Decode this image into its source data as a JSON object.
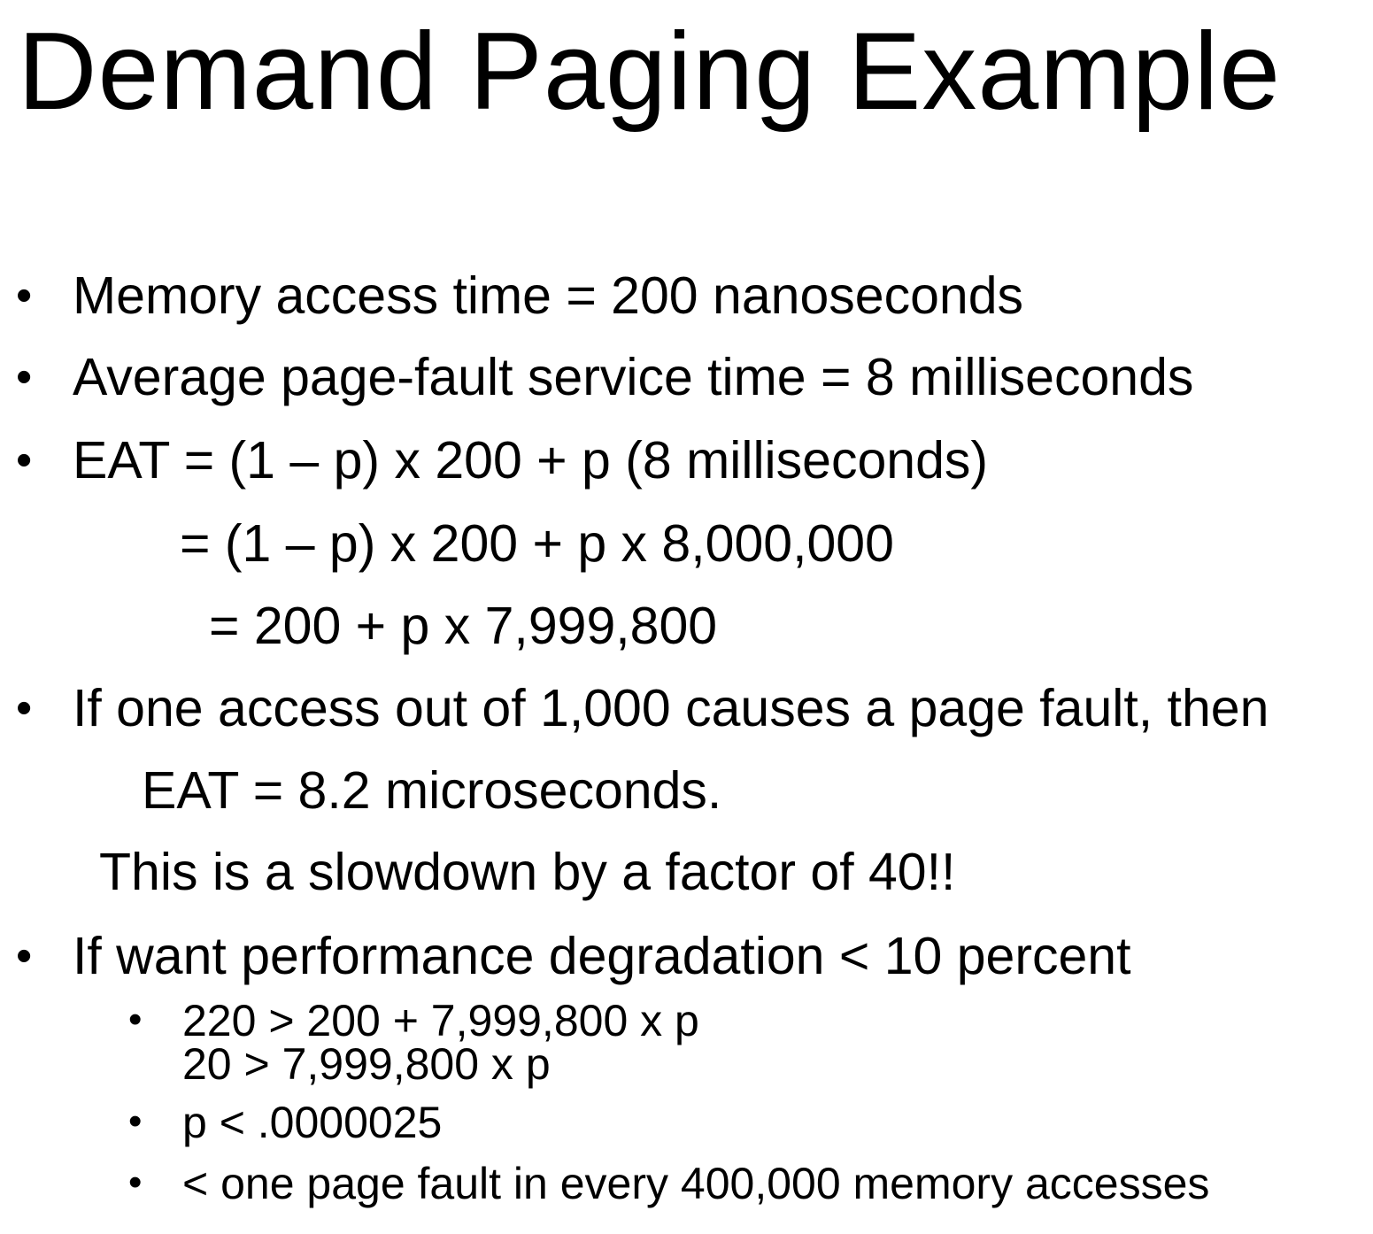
{
  "title": "Demand Paging Example",
  "bullet_glyph": "•",
  "items": [
    {
      "text": "Memory access time = 200 nanoseconds"
    },
    {
      "text": "Average page-fault service time = 8 milliseconds"
    },
    {
      "text": "EAT = (1 – p) x 200 + p (8 milliseconds)"
    },
    {
      "text": "= (1 – p) x 200 + p x 8,000,000"
    },
    {
      "text": "= 200 + p x 7,999,800"
    },
    {
      "text": "If one access out of 1,000 causes a page fault, then"
    },
    {
      "text": "EAT = 8.2 microseconds."
    },
    {
      "text": "This is a slowdown by a factor of 40!!"
    },
    {
      "text": "If want performance degradation < 10 percent"
    }
  ],
  "subitems": [
    {
      "text": "220 > 200 + 7,999,800 x p"
    },
    {
      "text": "20 > 7,999,800 x p"
    },
    {
      "text": "p < .0000025"
    },
    {
      "text": "< one page fault in every 400,000 memory accesses"
    }
  ]
}
